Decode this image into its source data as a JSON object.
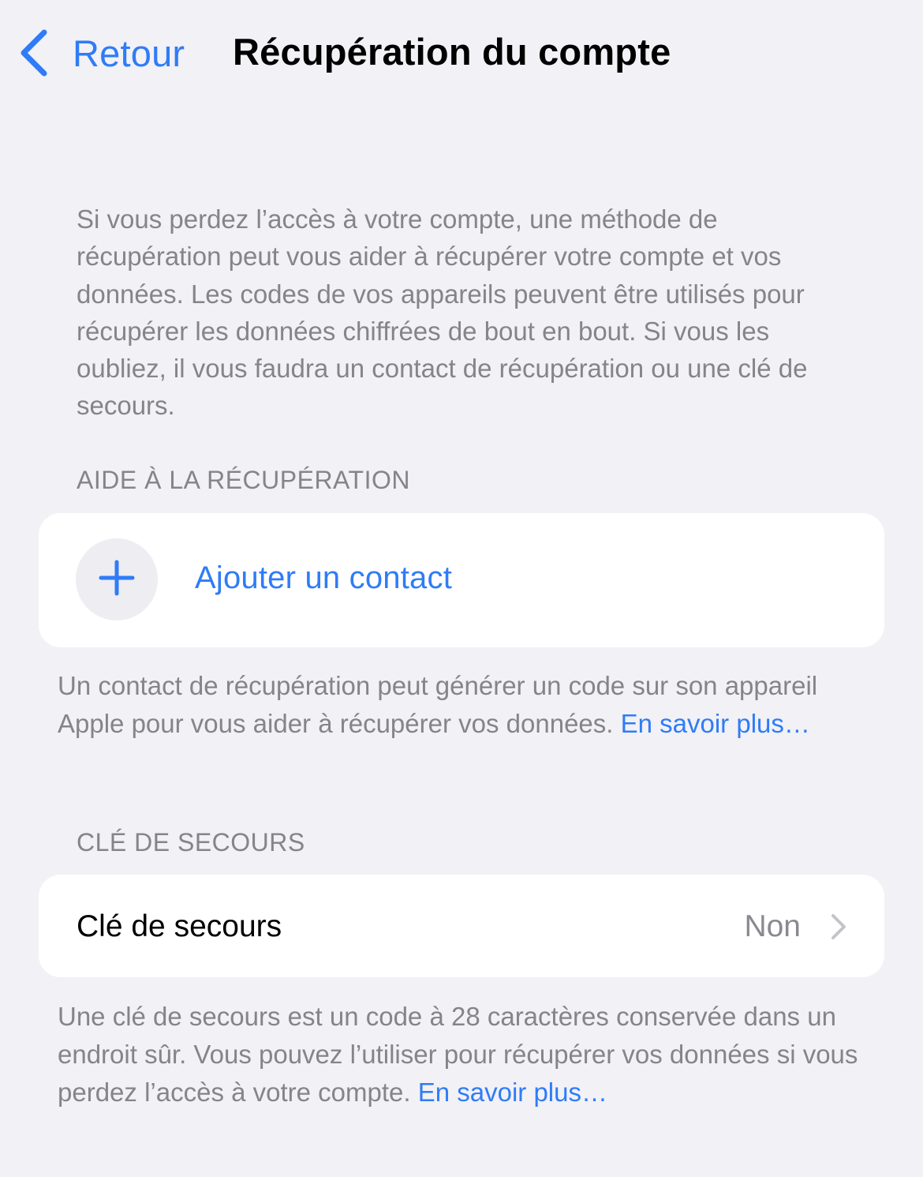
{
  "nav": {
    "back_label": "Retour",
    "title": "Récupération du compte"
  },
  "intro": "Si vous perdez l’accès à votre compte, une méthode de récupération peut vous aider à récupérer votre compte et vos données. Les codes de vos appareils peuvent être utilisés pour récupérer les données chiffrées de bout en bout. Si vous les oubliez, il vous faudra un contact de récupération ou une clé de secours.",
  "recovery_assistance": {
    "header": "AIDE À LA RÉCUPÉRATION",
    "add_contact_label": "Ajouter un contact",
    "footer_text": "Un contact de récupération peut générer un code sur son appareil Apple pour vous aider à récupérer vos données. ",
    "footer_link": "En savoir plus…"
  },
  "recovery_key": {
    "header": "CLÉ DE SECOURS",
    "row_label": "Clé de secours",
    "row_value": "Non",
    "footer_text": "Une clé de secours est un code à 28 caractères conservée dans un endroit sûr. Vous pouvez l’utiliser pour récupérer vos données si vous perdez l’accès à votre compte. ",
    "footer_link": "En savoir plus…"
  },
  "colors": {
    "accent": "#2f7cf6",
    "background": "#f2f1f6",
    "secondary_text": "#85848a",
    "card": "#ffffff"
  },
  "icons": {
    "back": "chevron-left-icon",
    "add": "plus-icon",
    "disclosure": "chevron-right-icon"
  }
}
